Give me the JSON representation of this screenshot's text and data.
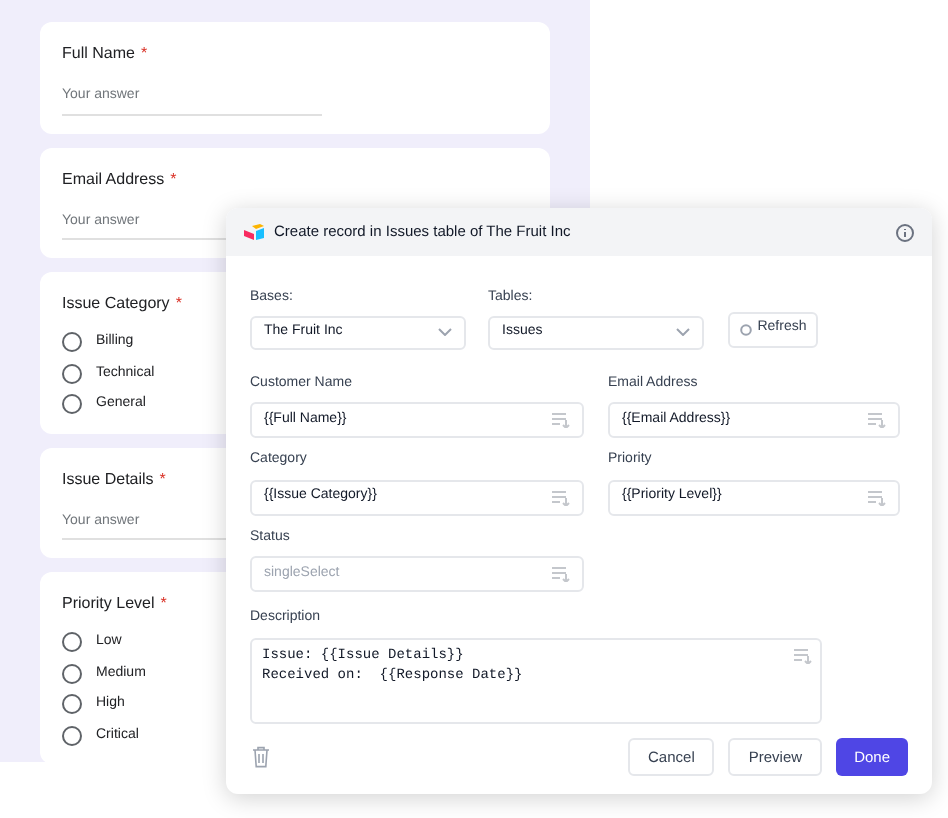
{
  "form": {
    "questions": [
      {
        "kind": "text",
        "label": "Full Name",
        "required_mark": "*",
        "placeholder": "Your answer"
      },
      {
        "kind": "text",
        "label": "Email Address",
        "required_mark": "*",
        "placeholder": "Your answer"
      },
      {
        "kind": "choice",
        "label": "Issue Category",
        "required_mark": "*",
        "options": [
          {
            "label": "Billing",
            "selected": false
          },
          {
            "label": "Technical",
            "selected": false
          },
          {
            "label": "General",
            "selected": false
          }
        ]
      },
      {
        "kind": "text",
        "label": "Issue Details",
        "required_mark": "*",
        "placeholder": "Your answer"
      },
      {
        "kind": "choice",
        "label": "Priority Level",
        "required_mark": "*",
        "options": [
          {
            "label": "Low",
            "selected": false
          },
          {
            "label": "Medium",
            "selected": false
          },
          {
            "label": "High",
            "selected": false
          },
          {
            "label": "Critical",
            "selected": false
          }
        ]
      }
    ]
  },
  "dialog": {
    "title": "Create record in Issues table of The Fruit Inc",
    "bases": {
      "label": "Bases:",
      "value": "The Fruit Inc"
    },
    "tables": {
      "label": "Tables:",
      "value": "Issues"
    },
    "refresh_button": "Refresh",
    "fields": [
      {
        "kind": "input",
        "label": "Customer Name",
        "value": "{{Full Name}}"
      },
      {
        "kind": "input",
        "label": "Email Address",
        "value": "{{Email Address}}"
      },
      {
        "kind": "input",
        "label": "Category",
        "value": "{{Issue Category}}"
      },
      {
        "kind": "input",
        "label": "Priority",
        "value": "{{Priority Level}}"
      },
      {
        "kind": "input",
        "label": "Status",
        "placeholder": "singleSelect"
      },
      {
        "kind": "textarea",
        "label": "Description",
        "value": "Issue: {{Issue Details}}\nReceived on:  {{Response Date}}"
      }
    ],
    "buttons": [
      {
        "label": "Cancel",
        "kind": "secondary"
      },
      {
        "label": "Preview",
        "kind": "secondary"
      },
      {
        "label": "Done",
        "kind": "primary"
      }
    ]
  }
}
